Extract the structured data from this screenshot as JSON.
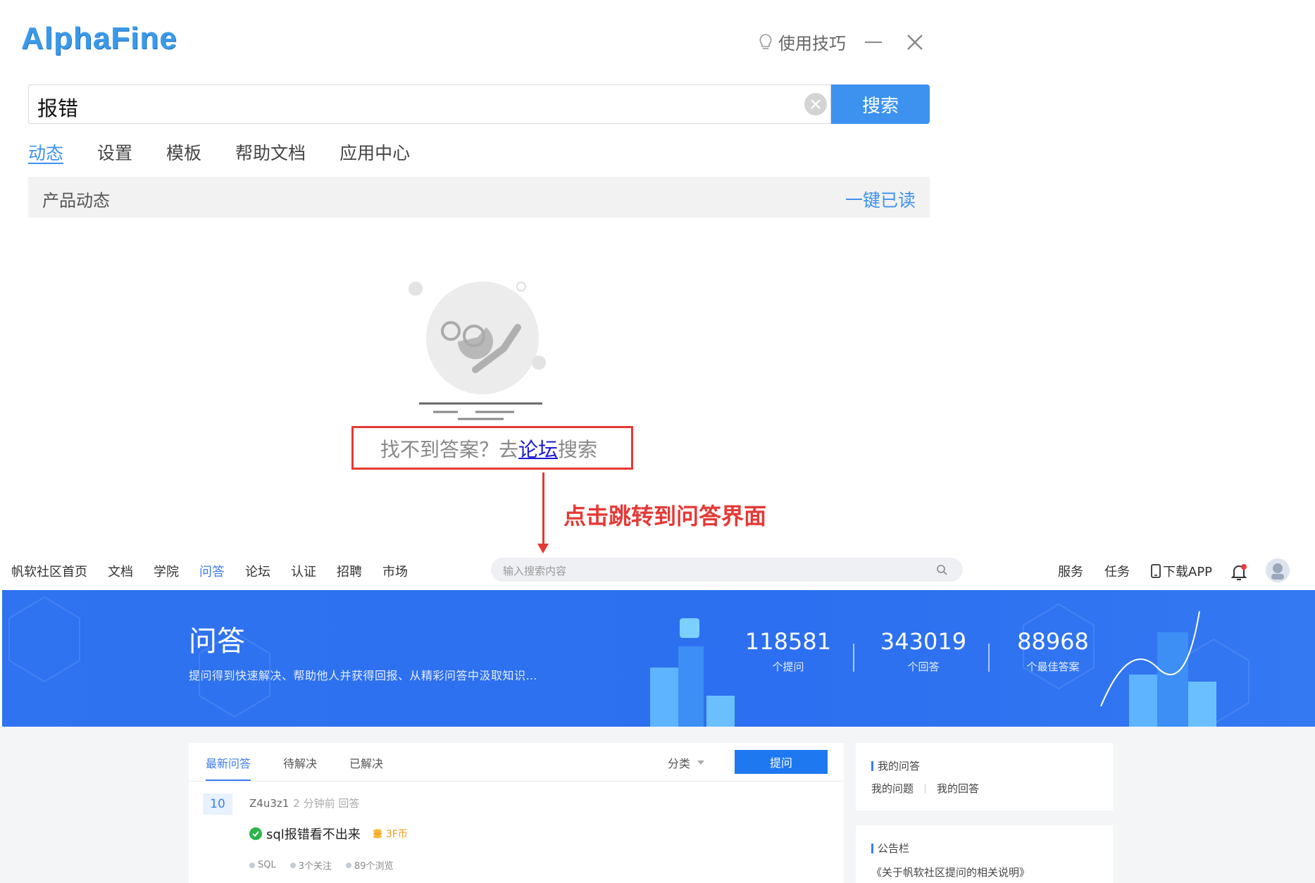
{
  "alphafine": {
    "logo": "AlphaFine",
    "tips_label": "使用技巧",
    "search_value": "报错",
    "search_button": "搜索",
    "tabs": [
      "动态",
      "设置",
      "模板",
      "帮助文档",
      "应用中心"
    ],
    "section_title": "产品动态",
    "section_action": "一键已读",
    "not_found_prefix": "找不到答案？去",
    "not_found_link": "论坛",
    "not_found_suffix": "搜索"
  },
  "annotation": "点击跳转到问答界面",
  "community": {
    "nav_links": [
      "帆软社区首页",
      "文档",
      "学院",
      "问答",
      "论坛",
      "认证",
      "招聘",
      "市场"
    ],
    "active_nav": "问答",
    "search_placeholder": "输入搜索内容",
    "nav_right": [
      "服务",
      "任务"
    ],
    "download_label": "下载APP",
    "banner": {
      "title": "问答",
      "subtitle": "提问得到快速解决、帮助他人并获得回报、从精彩问答中汲取知识…",
      "stats": [
        {
          "num": "118581",
          "label": "个提问"
        },
        {
          "num": "343019",
          "label": "个回答"
        },
        {
          "num": "88968",
          "label": "个最佳答案"
        }
      ]
    },
    "qa": {
      "tabs": [
        "最新问答",
        "待解决",
        "已解决"
      ],
      "category_label": "分类",
      "ask_button": "提问",
      "item": {
        "count": "10",
        "user": "Z4u3z1",
        "time": "2 分钟前 回答",
        "title": "sql报错看不出来",
        "coin": "3F币",
        "tag": "SQL",
        "follows": "3个关注",
        "views": "89个浏览"
      }
    },
    "side": {
      "my_qa_title": "我的问答",
      "my_questions": "我的问题",
      "my_answers": "我的回答",
      "notice_title": "公告栏",
      "notice_item": "《关于帆软社区提问的相关说明》"
    }
  },
  "colors": {
    "accent": "#3d92f0",
    "annotation_red": "#e53935",
    "banner_blue": "#2f73f0"
  }
}
